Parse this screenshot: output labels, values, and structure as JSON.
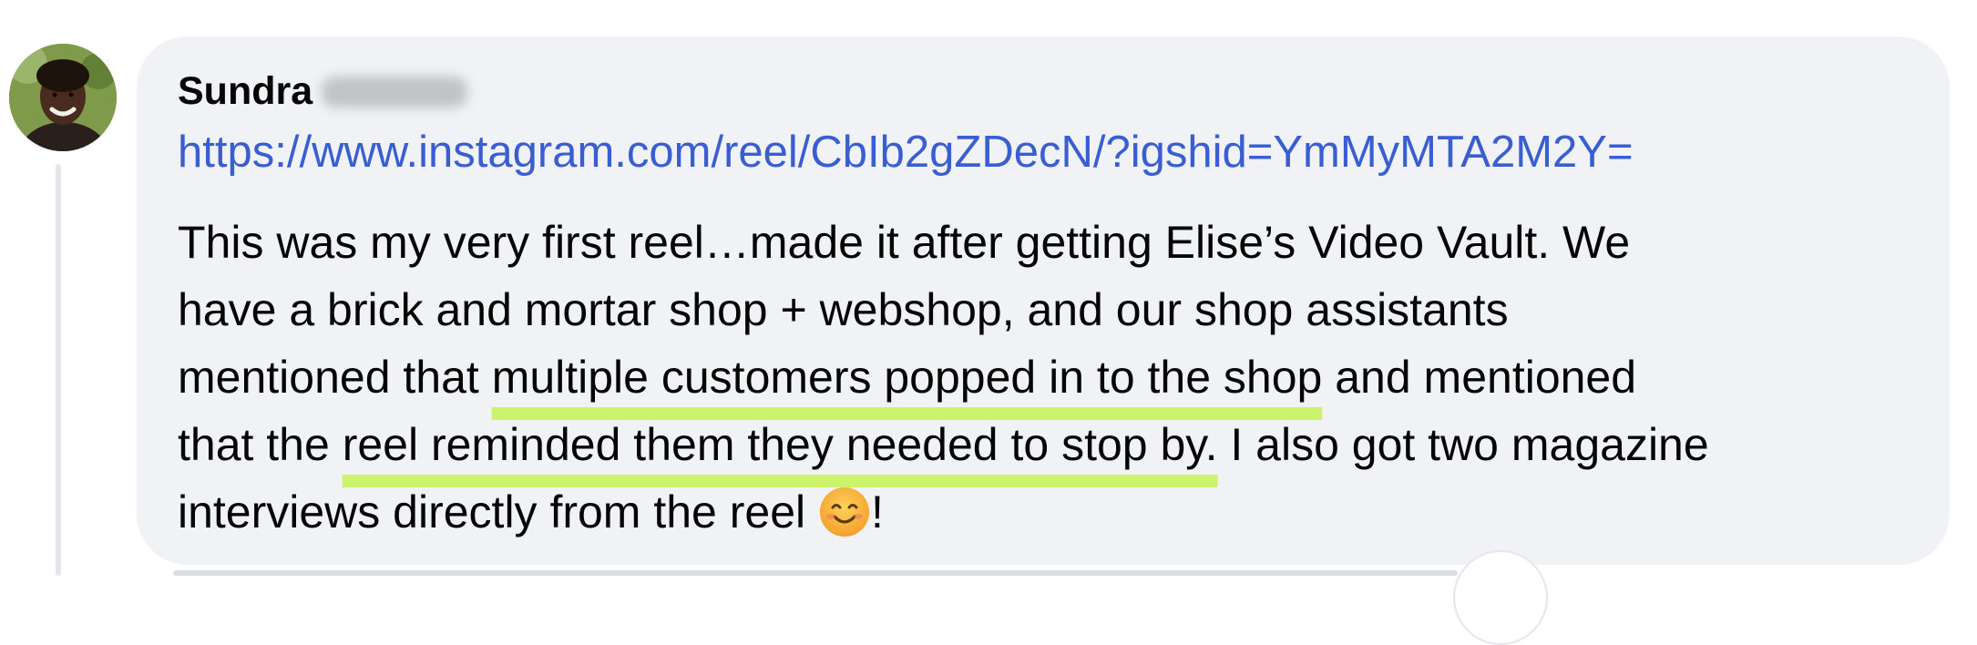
{
  "comment": {
    "author_first_name": "Sundra",
    "link": "https://www.instagram.com/reel/CbIb2gZDecN/?igshid=YmMyMTA2M2Y=",
    "lines": [
      {
        "a": "This was my very first reel…made it after getting Elise’s Video Vault. We"
      },
      {
        "a": "have a brick and mortar shop + webshop, and our shop assistants"
      },
      {
        "a": "mentioned that ",
        "highlight": "multiple customers popped in to the shop",
        "b": " and mentioned"
      },
      {
        "a": "that the ",
        "highlight": "reel reminded them they needed to stop by.",
        "b": " I also got two magazine"
      },
      {
        "a": "interviews directly from the reel ",
        "b": "!"
      }
    ],
    "emoji": "smiling-face-with-smiling-eyes-emoji",
    "highlight_color": "#cdf36c",
    "link_color": "#385ed1",
    "bubble_color": "#f0f2f5"
  }
}
